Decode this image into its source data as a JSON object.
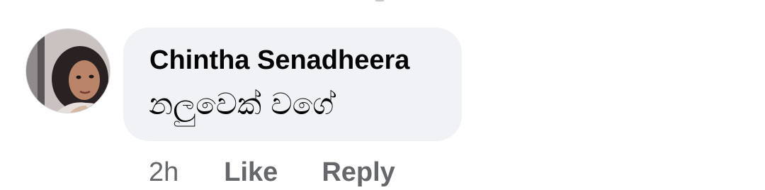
{
  "comment": {
    "author": "Chintha Senadheera",
    "text": "නලුවෙක් වගේ",
    "timestamp": "2h",
    "actions": {
      "like_label": "Like",
      "reply_label": "Reply"
    },
    "bubble_color": "#f0f2f5",
    "secondary_text_color": "#65676b",
    "avatar_icon": "profile-photo-avatar"
  }
}
